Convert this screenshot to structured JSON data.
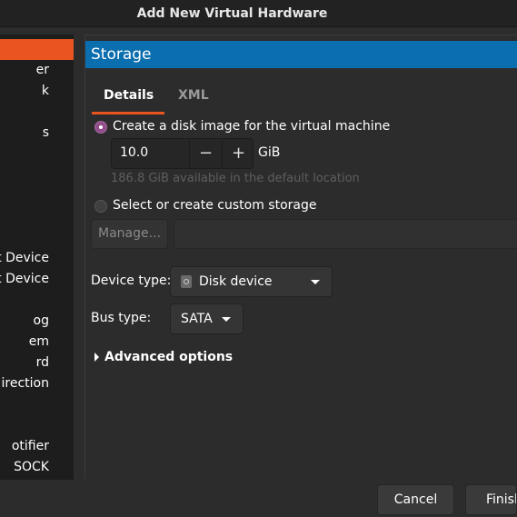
{
  "window": {
    "title": "Add New Virtual Hardware"
  },
  "sidebar": {
    "items": [
      {
        "label": "",
        "selected": true
      },
      {
        "label": "er"
      },
      {
        "label": "k"
      },
      {
        "label": "s"
      },
      {
        "label": "t Device"
      },
      {
        "label": "t Device"
      },
      {
        "label": "og"
      },
      {
        "label": "em"
      },
      {
        "label": "rd"
      },
      {
        "label": "irection"
      },
      {
        "label": "otifier"
      },
      {
        "label": "SOCK"
      }
    ]
  },
  "main": {
    "header": "Storage",
    "tabs": [
      {
        "label": "Details",
        "active": true
      },
      {
        "label": "XML",
        "active": false
      }
    ],
    "create_disk_label": "Create a disk image for the virtual machine",
    "size_value": "10.0",
    "size_unit": "GiB",
    "minus_symbol": "−",
    "plus_symbol": "+",
    "available_text": "186.8 GiB available in the default location",
    "custom_storage_label": "Select or create custom storage",
    "manage_label": "Manage...",
    "device_type_label": "Device type:",
    "device_type_value": "Disk device",
    "bus_type_label": "Bus type:",
    "bus_type_value": "SATA",
    "advanced_label": "Advanced options"
  },
  "footer": {
    "cancel_label": "Cancel",
    "finish_label": "Finish"
  },
  "colors": {
    "accent": "#e95420",
    "header_blue": "#0a6eaf",
    "radio_purple": "#924d8b"
  }
}
